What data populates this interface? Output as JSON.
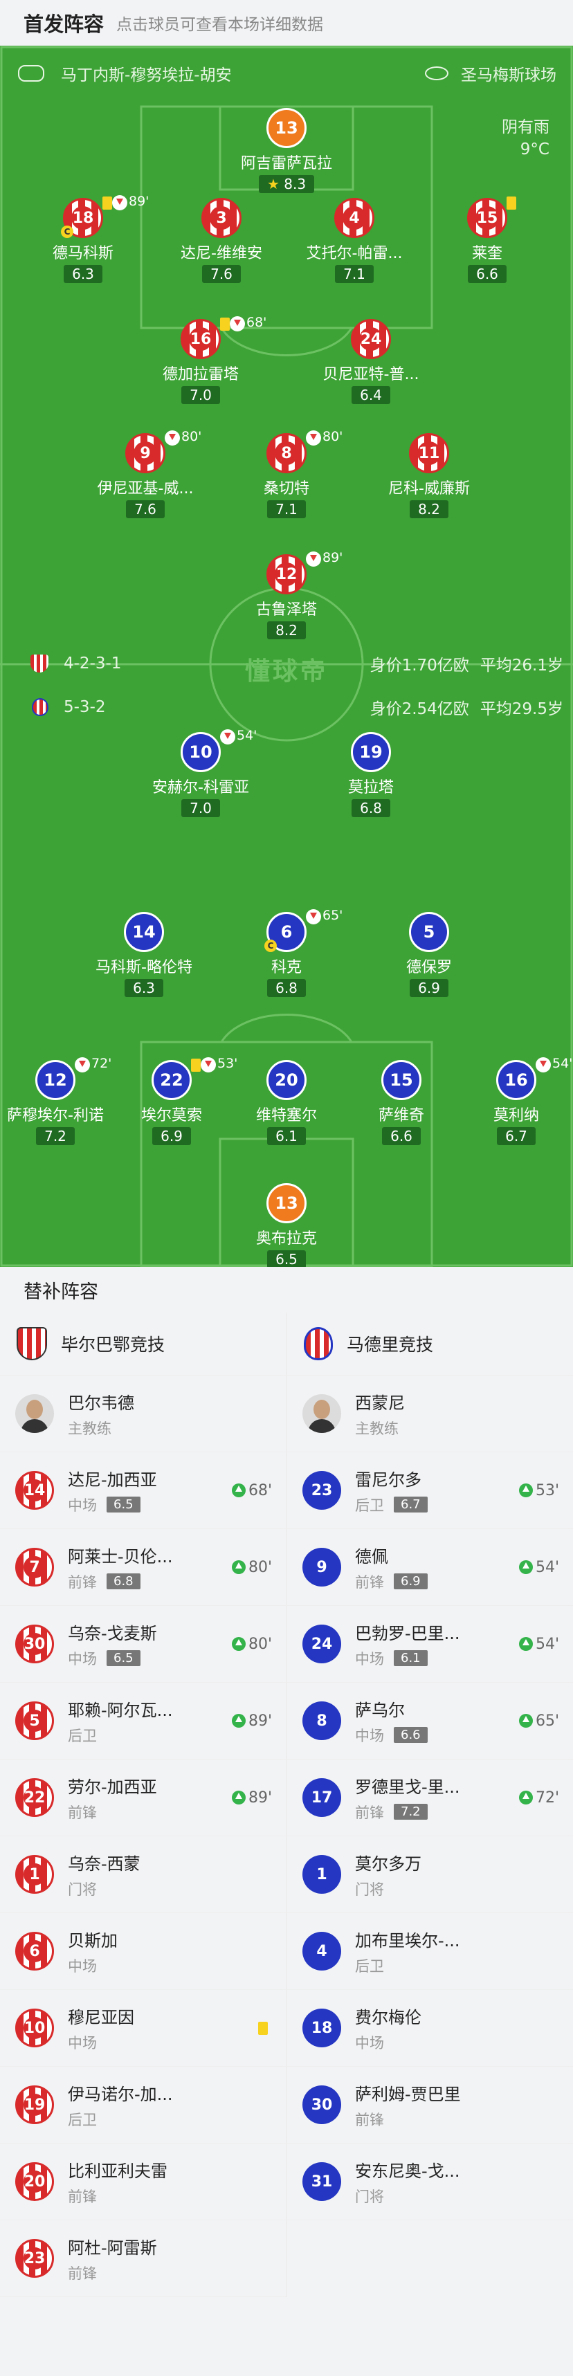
{
  "header": {
    "title": "首发阵容",
    "hint": "点击球员可查看本场详细数据"
  },
  "pitch": {
    "referee": "马丁内斯-穆努埃拉-胡安",
    "stadium": "圣马梅斯球场",
    "weather": "阴有雨",
    "temperature": "9°C",
    "watermark": "懂球帝",
    "home_formation": "4-2-3-1",
    "home_value": "身价1.70亿欧",
    "home_age": "平均26.1岁",
    "away_formation": "5-3-2",
    "away_value": "身价2.54亿欧",
    "away_age": "平均29.5岁"
  },
  "home_players": [
    {
      "num": "13",
      "name": "阿吉雷萨瓦拉",
      "rating": "8.3",
      "star": true
    },
    {
      "num": "18",
      "name": "德马科斯",
      "rating": "6.3",
      "sub": "89'",
      "card": true,
      "captain": "C"
    },
    {
      "num": "3",
      "name": "达尼-维维安",
      "rating": "7.6"
    },
    {
      "num": "4",
      "name": "艾托尔-帕雷...",
      "rating": "7.1"
    },
    {
      "num": "15",
      "name": "莱奎",
      "rating": "6.6",
      "card": true
    },
    {
      "num": "16",
      "name": "德加拉雷塔",
      "rating": "7.0",
      "sub": "68'",
      "card": true
    },
    {
      "num": "24",
      "name": "贝尼亚特-普...",
      "rating": "6.4"
    },
    {
      "num": "9",
      "name": "伊尼亚基-威...",
      "rating": "7.6",
      "sub": "80'"
    },
    {
      "num": "8",
      "name": "桑切特",
      "rating": "7.1",
      "sub": "80'"
    },
    {
      "num": "11",
      "name": "尼科-威廉斯",
      "rating": "8.2"
    },
    {
      "num": "12",
      "name": "古鲁泽塔",
      "rating": "8.2",
      "sub": "89'"
    }
  ],
  "away_players": [
    {
      "num": "10",
      "name": "安赫尔-科雷亚",
      "rating": "7.0",
      "sub": "54'"
    },
    {
      "num": "19",
      "name": "莫拉塔",
      "rating": "6.8"
    },
    {
      "num": "14",
      "name": "马科斯-略伦特",
      "rating": "6.3"
    },
    {
      "num": "6",
      "name": "科克",
      "rating": "6.8",
      "sub": "65'",
      "captain": "C"
    },
    {
      "num": "5",
      "name": "德保罗",
      "rating": "6.9"
    },
    {
      "num": "12",
      "name": "萨穆埃尔-利诺",
      "rating": "7.2",
      "sub": "72'"
    },
    {
      "num": "22",
      "name": "埃尔莫索",
      "rating": "6.9",
      "sub": "53'",
      "card": true
    },
    {
      "num": "20",
      "name": "维特塞尔",
      "rating": "6.1"
    },
    {
      "num": "15",
      "name": "萨维奇",
      "rating": "6.6"
    },
    {
      "num": "16",
      "name": "莫利纳",
      "rating": "6.7",
      "sub": "54'"
    },
    {
      "num": "13",
      "name": "奥布拉克",
      "rating": "6.5"
    }
  ],
  "subs": {
    "title": "替补阵容",
    "home_team": "毕尔巴鄂竞技",
    "away_team": "马德里竞技",
    "home_coach": {
      "name": "巴尔韦德",
      "role": "主教练"
    },
    "away_coach": {
      "name": "西蒙尼",
      "role": "主教练"
    },
    "home": [
      {
        "num": "14",
        "name": "达尼-加西亚",
        "pos": "中场",
        "rating": "6.5",
        "min": "68'"
      },
      {
        "num": "7",
        "name": "阿莱士-贝伦...",
        "pos": "前锋",
        "rating": "6.8",
        "min": "80'"
      },
      {
        "num": "30",
        "name": "乌奈-戈麦斯",
        "pos": "中场",
        "rating": "6.5",
        "min": "80'"
      },
      {
        "num": "5",
        "name": "耶赖-阿尔瓦...",
        "pos": "后卫",
        "min": "89'"
      },
      {
        "num": "22",
        "name": "劳尔-加西亚",
        "pos": "前锋",
        "min": "89'"
      },
      {
        "num": "1",
        "name": "乌奈-西蒙",
        "pos": "门将"
      },
      {
        "num": "6",
        "name": "贝斯加",
        "pos": "中场"
      },
      {
        "num": "10",
        "name": "穆尼亚因",
        "pos": "中场",
        "card": true
      },
      {
        "num": "19",
        "name": "伊马诺尔-加...",
        "pos": "后卫"
      },
      {
        "num": "20",
        "name": "比利亚利夫雷",
        "pos": "前锋"
      },
      {
        "num": "23",
        "name": "阿杜-阿雷斯",
        "pos": "前锋"
      }
    ],
    "away": [
      {
        "num": "23",
        "name": "雷尼尔多",
        "pos": "后卫",
        "rating": "6.7",
        "min": "53'"
      },
      {
        "num": "9",
        "name": "德佩",
        "pos": "前锋",
        "rating": "6.9",
        "min": "54'"
      },
      {
        "num": "24",
        "name": "巴勃罗-巴里...",
        "pos": "中场",
        "rating": "6.1",
        "min": "54'"
      },
      {
        "num": "8",
        "name": "萨乌尔",
        "pos": "中场",
        "rating": "6.6",
        "min": "65'"
      },
      {
        "num": "17",
        "name": "罗德里戈-里...",
        "pos": "前锋",
        "rating": "7.2",
        "min": "72'"
      },
      {
        "num": "1",
        "name": "莫尔多万",
        "pos": "门将"
      },
      {
        "num": "4",
        "name": "加布里埃尔-...",
        "pos": "后卫"
      },
      {
        "num": "18",
        "name": "费尔梅伦",
        "pos": "中场"
      },
      {
        "num": "30",
        "name": "萨利姆-贾巴里",
        "pos": "前锋"
      },
      {
        "num": "31",
        "name": "安东尼奥-戈...",
        "pos": "门将"
      }
    ]
  },
  "colors": {
    "pitch": "#3ea336",
    "home": "#d82a2a",
    "away": "#2436c2",
    "gk": "#f07a1e",
    "card": "#f7d21e"
  }
}
